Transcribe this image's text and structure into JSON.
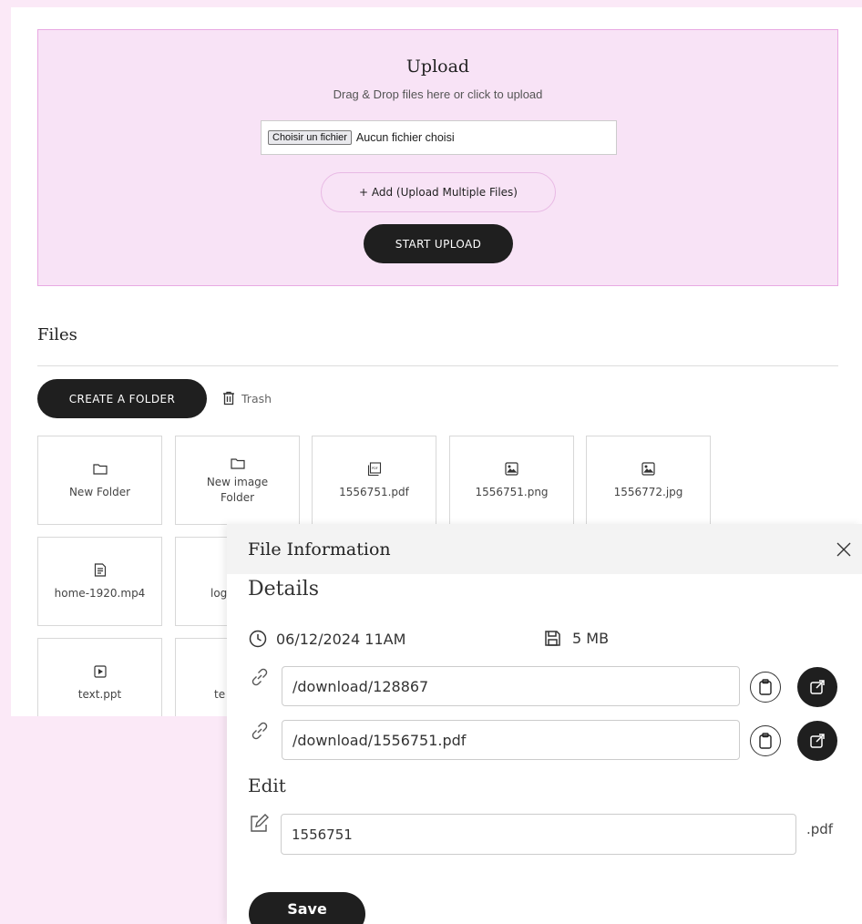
{
  "upload": {
    "title": "Upload",
    "subtitle": "Drag & Drop files here or click to upload",
    "choose_button": "Choisir un fichier",
    "no_file_text": "Aucun fichier choisi",
    "add_multiple_label": "+ Add (Upload Multiple Files)",
    "start_label": "START UPLOAD"
  },
  "files": {
    "title": "Files",
    "create_folder_label": "CREATE A FOLDER",
    "trash_label": "Trash",
    "tiles": [
      {
        "label": "New Folder",
        "icon": "folder-icon"
      },
      {
        "label": "New image Folder",
        "icon": "folder-icon"
      },
      {
        "label": "1556751.pdf",
        "icon": "pdf-icon"
      },
      {
        "label": "1556751.png",
        "icon": "image-icon"
      },
      {
        "label": "1556772.jpg",
        "icon": "image-icon"
      },
      {
        "label": "home-1920.mp4",
        "icon": "document-icon"
      },
      {
        "label": "log",
        "icon": "document-icon"
      },
      {
        "label": "text.ppt",
        "icon": "play-icon"
      },
      {
        "label": "te",
        "icon": "document-icon"
      }
    ]
  },
  "file_info": {
    "title": "File Information",
    "details_heading": "Details",
    "date": "06/12/2024 11AM",
    "size": "5 MB",
    "links": [
      "/download/128867",
      "/download/1556751.pdf"
    ],
    "edit_heading": "Edit",
    "filename": "1556751",
    "extension": ".pdf",
    "save_label": "Save"
  }
}
